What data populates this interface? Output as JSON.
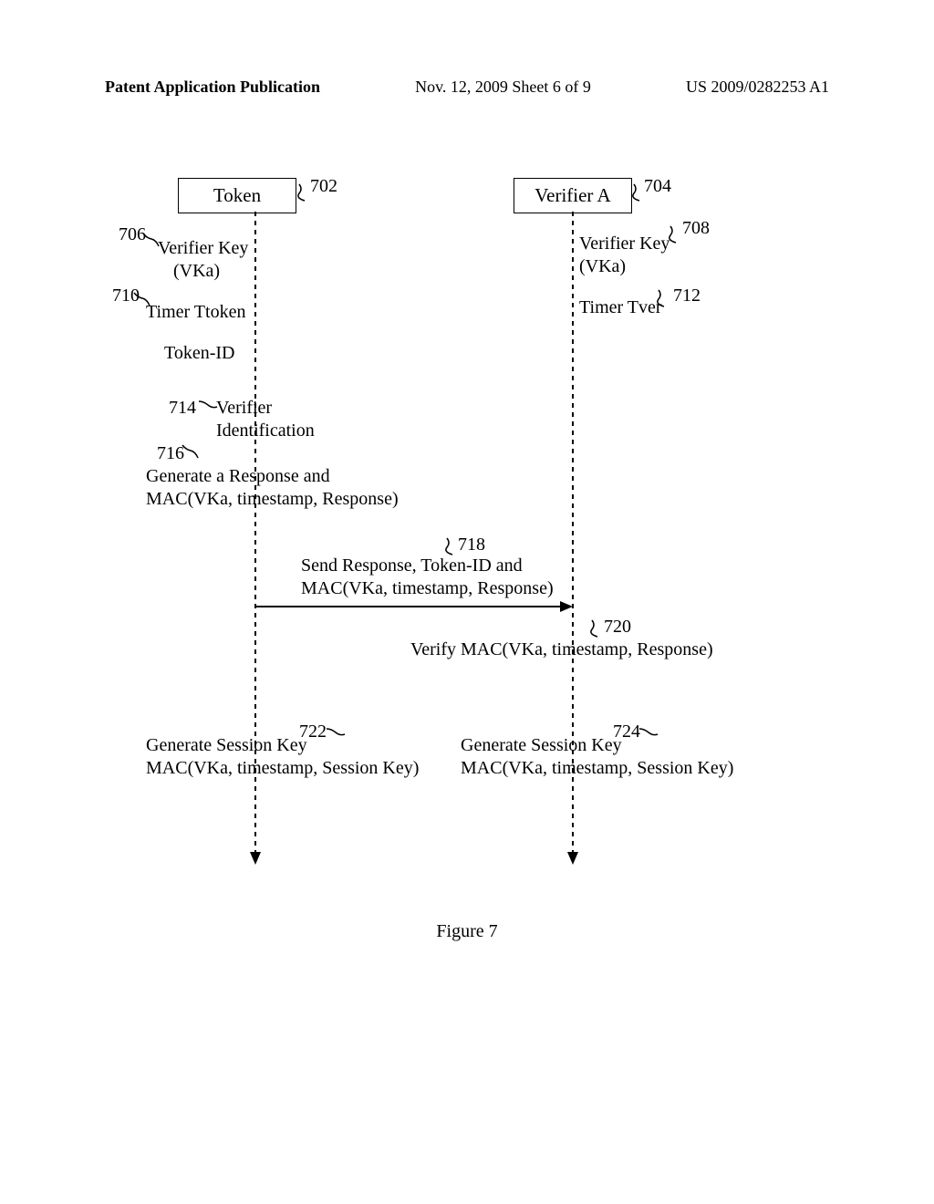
{
  "header": {
    "left": "Patent Application Publication",
    "center": "Nov. 12, 2009  Sheet 6 of 9",
    "right": "US 2009/0282253 A1"
  },
  "token": {
    "box_label": "Token",
    "box_ref": "702",
    "verifier_key_label": "Verifier Key",
    "verifier_key_sub": "(VKa)",
    "verifier_key_ref": "706",
    "timer_label": "Timer Ttoken",
    "timer_ref": "710",
    "token_id_label": "Token-ID",
    "verifier_ident_label": "Verifier\nIdentification",
    "verifier_ident_ref": "714",
    "gen_response_label": "Generate a Response and\nMAC(VKa, timestamp, Response)",
    "gen_response_ref": "716",
    "gen_session_label": "Generate Session Key\nMAC(VKa, timestamp, Session Key)",
    "gen_session_ref": "722"
  },
  "verifier": {
    "box_label": "Verifier A",
    "box_ref": "704",
    "verifier_key_label": "Verifier Key",
    "verifier_key_sub": "(VKa)",
    "verifier_key_ref": "708",
    "timer_label": "Timer Tver",
    "timer_ref": "712",
    "verify_mac_label": "Verify MAC(VKa, timestamp, Response)",
    "verify_mac_ref": "720",
    "gen_session_label": "Generate Session Key\nMAC(VKa, timestamp, Session Key)",
    "gen_session_ref": "724"
  },
  "message": {
    "send_label": "Send Response, Token-ID and\nMAC(VKa, timestamp, Response)",
    "send_ref": "718"
  },
  "caption": "Figure 7"
}
